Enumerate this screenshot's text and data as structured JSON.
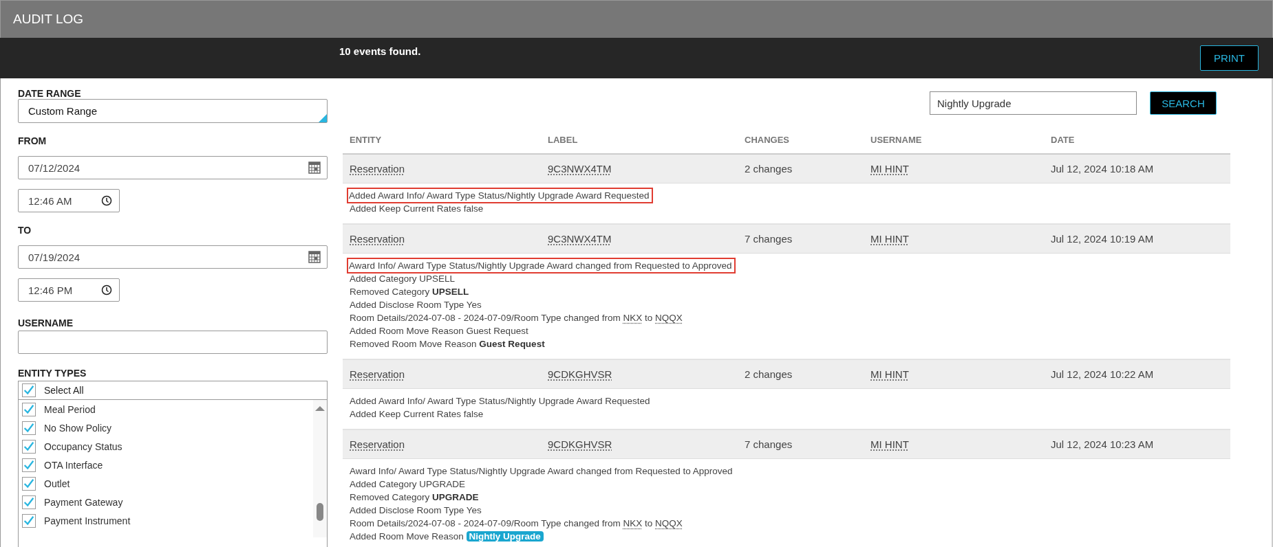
{
  "header": {
    "title": "AUDIT LOG"
  },
  "toolbar": {
    "result_count": "10 events found.",
    "print_button": "PRINT"
  },
  "filters": {
    "date_range": {
      "label": "DATE RANGE",
      "value": "Custom Range"
    },
    "from": {
      "label": "FROM",
      "date": "07/12/2024",
      "time": "12:46 AM"
    },
    "to": {
      "label": "TO",
      "date": "07/19/2024",
      "time": "12:46 PM"
    },
    "username": {
      "label": "USERNAME"
    },
    "entity_types": {
      "label": "ENTITY TYPES",
      "select_all": {
        "label": "Select All",
        "checked": true
      },
      "items": [
        {
          "label": "Meal Period",
          "checked": true
        },
        {
          "label": "No Show Policy",
          "checked": true
        },
        {
          "label": "Occupancy Status",
          "checked": true
        },
        {
          "label": "OTA Interface",
          "checked": true
        },
        {
          "label": "Outlet",
          "checked": true
        },
        {
          "label": "Payment Gateway",
          "checked": true
        },
        {
          "label": "Payment Instrument",
          "checked": true
        }
      ]
    }
  },
  "search": {
    "value": "Nightly Upgrade",
    "button": "SEARCH"
  },
  "table": {
    "columns": [
      "ENTITY",
      "LABEL",
      "CHANGES",
      "USERNAME",
      "DATE"
    ],
    "events": [
      {
        "entity": "Reservation",
        "label": "9C3NWX4TM",
        "changes": "2 changes",
        "username": "MI HINT",
        "date": "Jul 12, 2024 10:18 AM",
        "details": [
          {
            "boxed": true,
            "segments": [
              {
                "kind": "plain",
                "text": "Added Award Info/ Award Type Status/Nightly Upgrade Award Requested"
              }
            ]
          },
          {
            "boxed": false,
            "segments": [
              {
                "kind": "plain",
                "text": "Added Keep Current Rates false"
              }
            ]
          }
        ]
      },
      {
        "entity": "Reservation",
        "label": "9C3NWX4TM",
        "changes": "7 changes",
        "username": "MI HINT",
        "date": "Jul 12, 2024 10:19 AM",
        "details": [
          {
            "boxed": true,
            "segments": [
              {
                "kind": "plain",
                "text": "Award Info/ Award Type Status/Nightly Upgrade Award changed from Requested to Approved"
              }
            ]
          },
          {
            "boxed": false,
            "segments": [
              {
                "kind": "plain",
                "text": "Added Category UPSELL"
              }
            ]
          },
          {
            "boxed": false,
            "segments": [
              {
                "kind": "plain",
                "text": "Removed Category"
              },
              {
                "kind": "bold",
                "text": "UPSELL"
              }
            ]
          },
          {
            "boxed": false,
            "segments": [
              {
                "kind": "plain",
                "text": "Added Disclose Room Type Yes"
              }
            ]
          },
          {
            "boxed": false,
            "segments": [
              {
                "kind": "plain",
                "text": "Room Details/2024-07-08 - 2024-07-09/Room Type changed from"
              },
              {
                "kind": "code",
                "text": "NKX"
              },
              {
                "kind": "plain",
                "text": "to"
              },
              {
                "kind": "code",
                "text": "NQQX"
              }
            ]
          },
          {
            "boxed": false,
            "segments": [
              {
                "kind": "plain",
                "text": "Added Room Move Reason Guest Request"
              }
            ]
          },
          {
            "boxed": false,
            "segments": [
              {
                "kind": "plain",
                "text": "Removed Room Move Reason"
              },
              {
                "kind": "bold",
                "text": "Guest Request"
              }
            ]
          }
        ]
      },
      {
        "entity": "Reservation",
        "label": "9CDKGHVSR",
        "changes": "2 changes",
        "username": "MI HINT",
        "date": "Jul 12, 2024 10:22 AM",
        "details": [
          {
            "boxed": false,
            "segments": [
              {
                "kind": "plain",
                "text": "Added Award Info/ Award Type Status/Nightly Upgrade Award Requested"
              }
            ]
          },
          {
            "boxed": false,
            "segments": [
              {
                "kind": "plain",
                "text": "Added Keep Current Rates false"
              }
            ]
          }
        ]
      },
      {
        "entity": "Reservation",
        "label": "9CDKGHVSR",
        "changes": "7 changes",
        "username": "MI HINT",
        "date": "Jul 12, 2024 10:23 AM",
        "details": [
          {
            "boxed": false,
            "segments": [
              {
                "kind": "plain",
                "text": "Award Info/ Award Type Status/Nightly Upgrade Award changed from Requested to Approved"
              }
            ]
          },
          {
            "boxed": false,
            "segments": [
              {
                "kind": "plain",
                "text": "Added Category UPGRADE"
              }
            ]
          },
          {
            "boxed": false,
            "segments": [
              {
                "kind": "plain",
                "text": "Removed Category"
              },
              {
                "kind": "bold",
                "text": "UPGRADE"
              }
            ]
          },
          {
            "boxed": false,
            "segments": [
              {
                "kind": "plain",
                "text": "Added Disclose Room Type Yes"
              }
            ]
          },
          {
            "boxed": false,
            "segments": [
              {
                "kind": "plain",
                "text": "Room Details/2024-07-08 - 2024-07-09/Room Type changed from"
              },
              {
                "kind": "code",
                "text": "NKX"
              },
              {
                "kind": "plain",
                "text": "to"
              },
              {
                "kind": "code",
                "text": "NQQX"
              }
            ]
          },
          {
            "boxed": false,
            "segments": [
              {
                "kind": "plain",
                "text": "Added Room Move Reason"
              },
              {
                "kind": "match",
                "text": "Nightly Upgrade"
              }
            ]
          }
        ]
      }
    ]
  }
}
